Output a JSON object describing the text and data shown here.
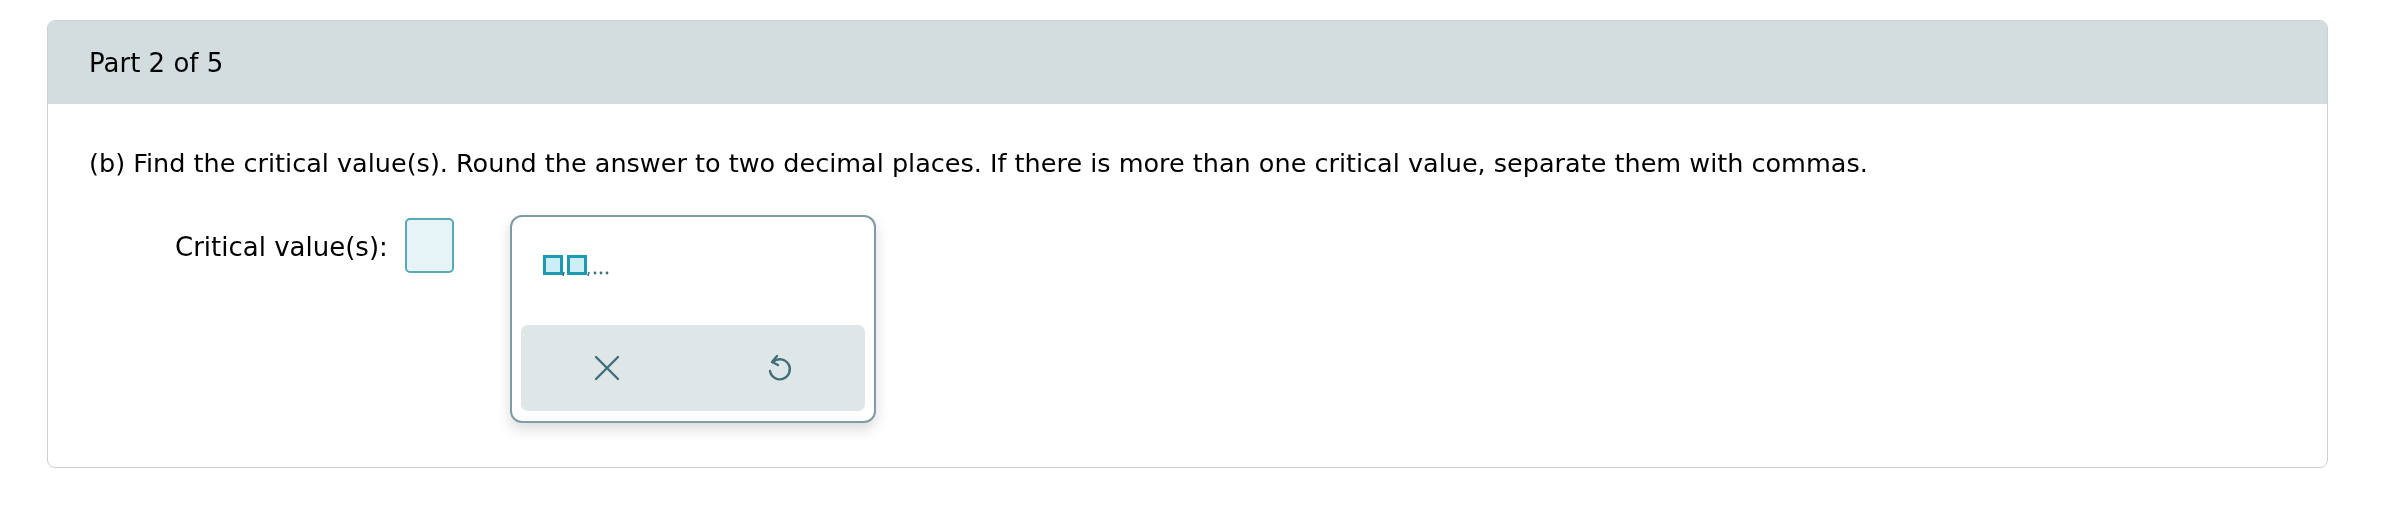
{
  "header": {
    "title": "Part 2 of 5"
  },
  "question": "(b) Find the critical value(s). Round the answer to two decimal places. If there is more than one critical value, separate them with commas.",
  "answer": {
    "label": "Critical value(s):",
    "palette_open": true
  }
}
